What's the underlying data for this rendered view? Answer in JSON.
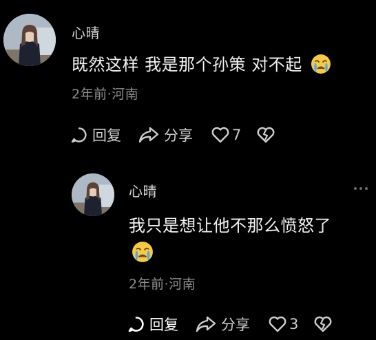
{
  "comments": [
    {
      "username": "心晴",
      "text": "既然这样 我是那个孙策 对不起",
      "emoji": "crying-face",
      "meta": "2年前·河南",
      "reply_label": "回复",
      "share_label": "分享",
      "like_count": "7"
    },
    {
      "username": "心晴",
      "text": "我只是想让他不那么愤怒了",
      "emoji": "crying-face",
      "meta": "2年前·河南",
      "reply_label": "回复",
      "share_label": "分享",
      "like_count": "3"
    }
  ],
  "colors": {
    "background": "#000000",
    "text": "#f2f2f2",
    "meta": "#8f8f8f",
    "action": "#cfcfcf"
  }
}
